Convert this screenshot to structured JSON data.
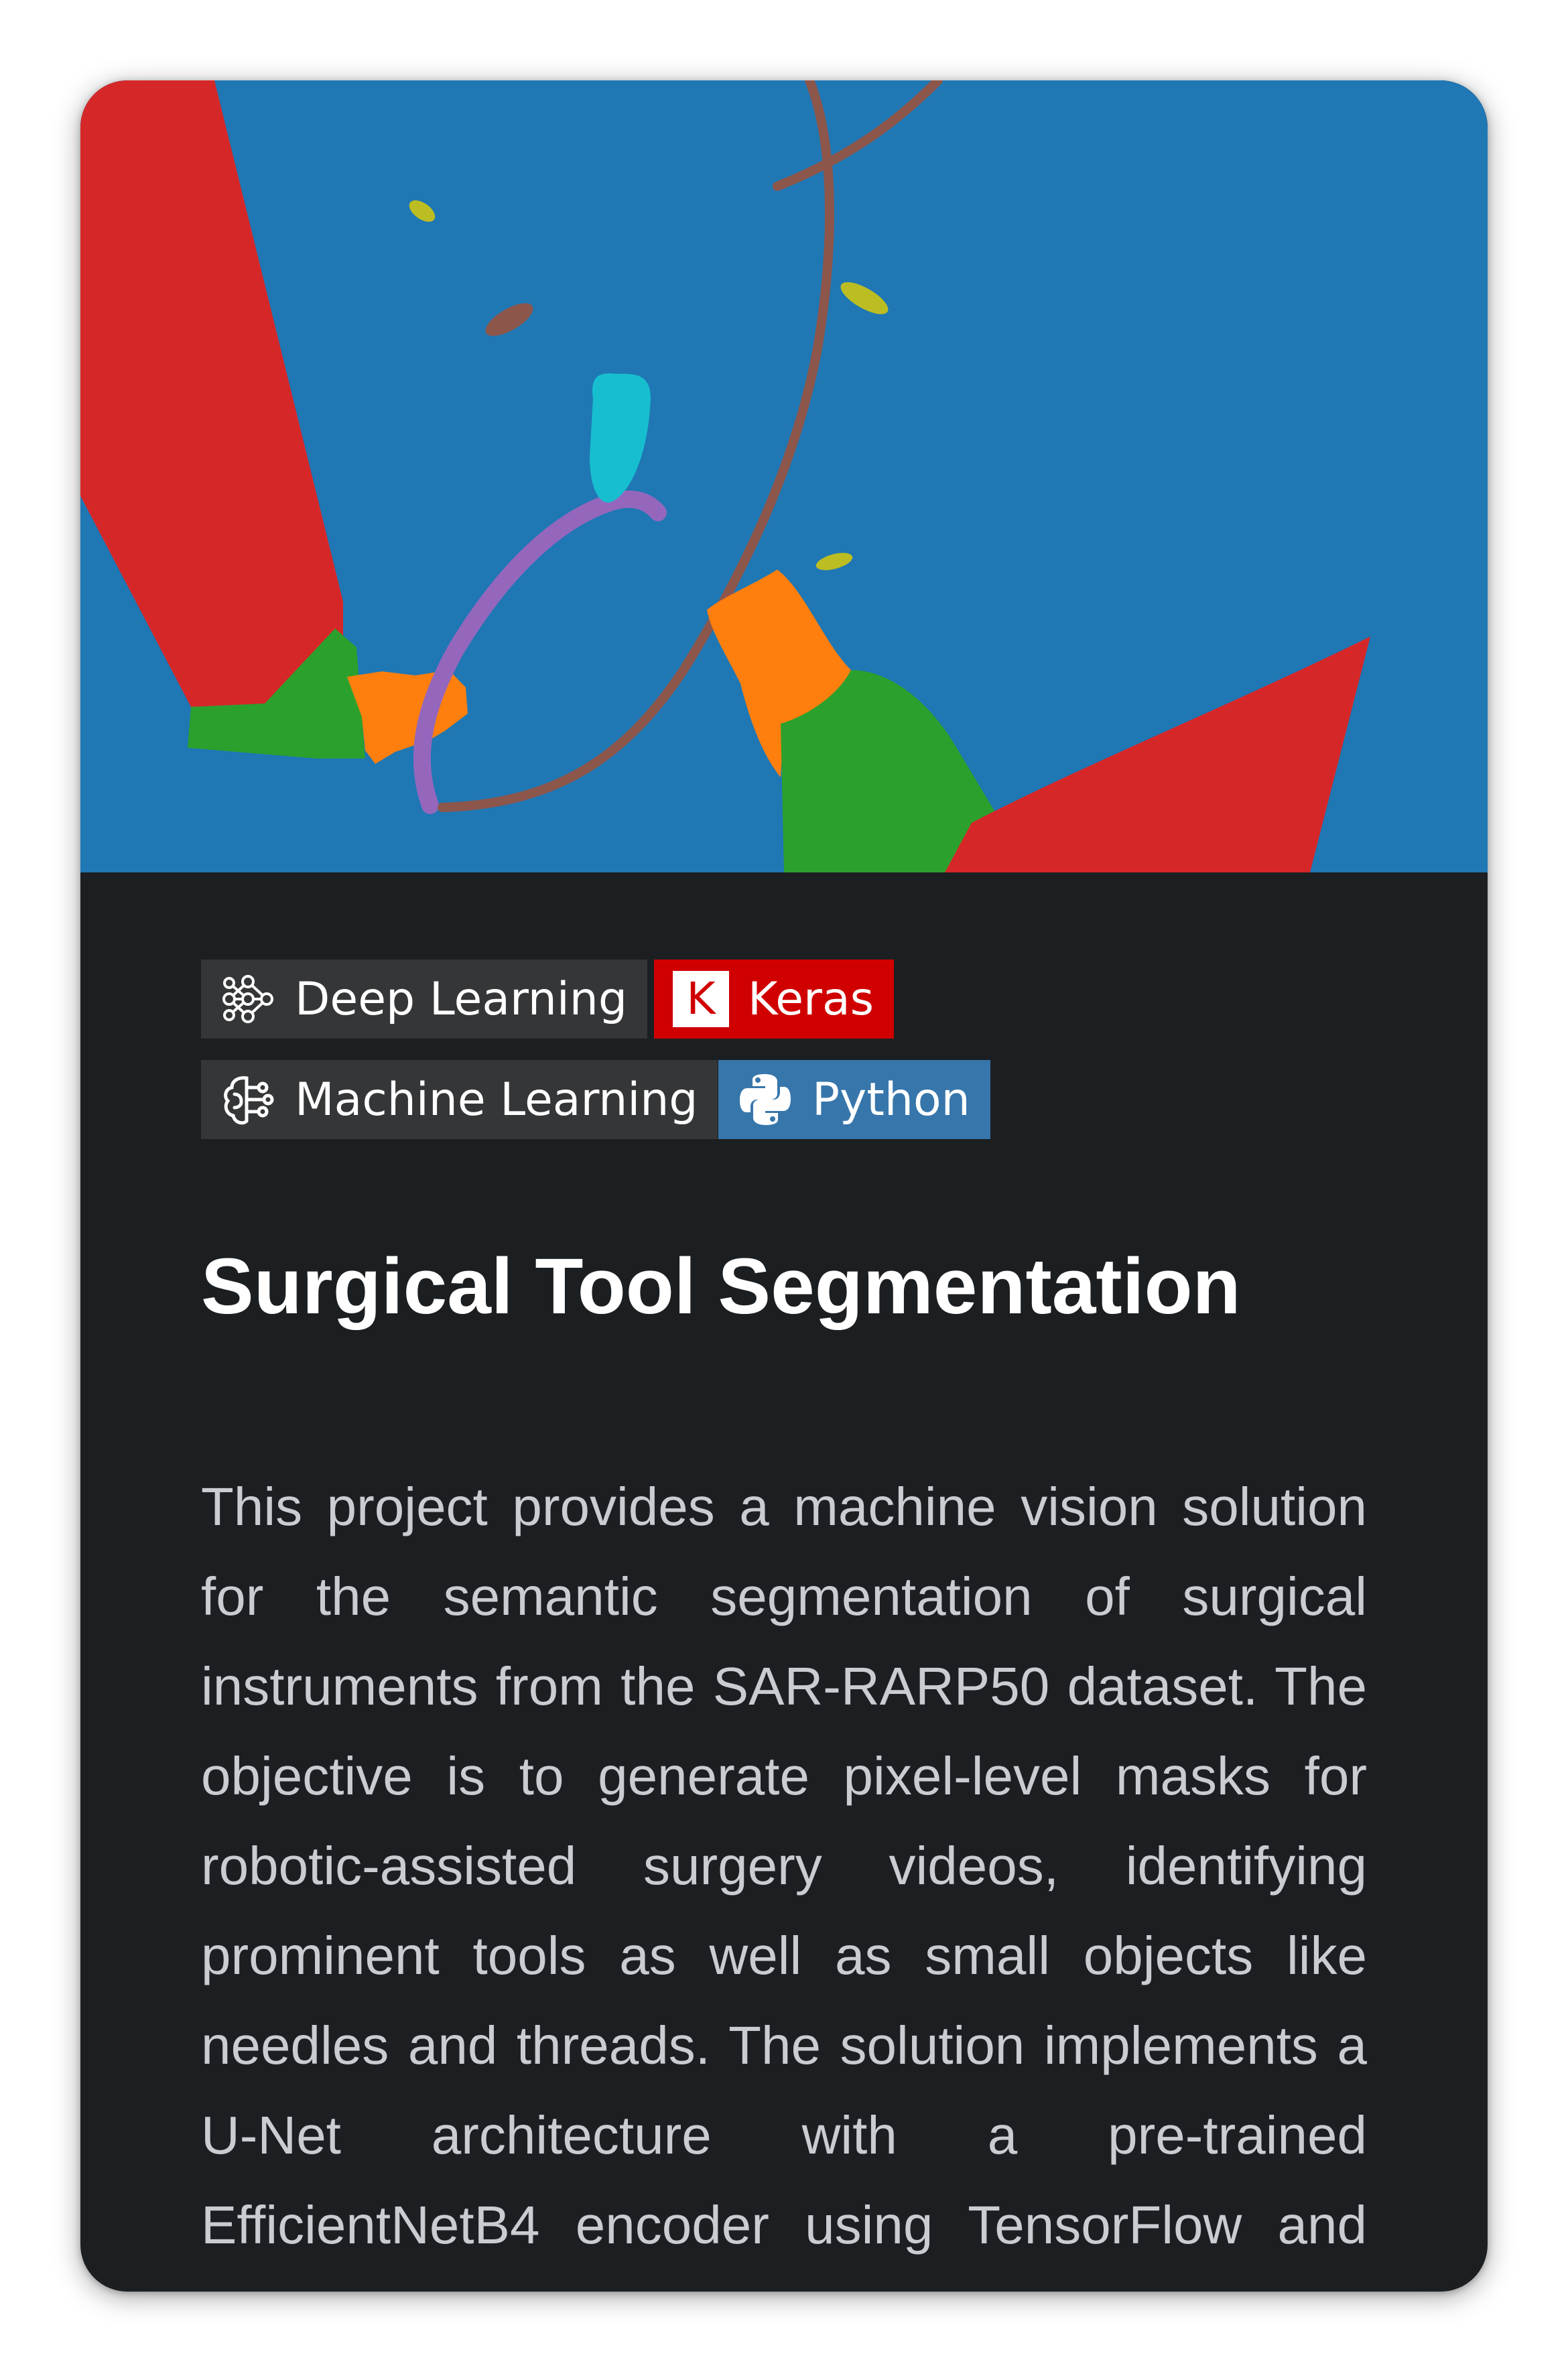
{
  "card": {
    "image_alt": "Segmentation mask of surgical instruments",
    "tags": [
      {
        "label": "Deep Learning",
        "icon": "neural-network-icon",
        "color": "#343638"
      },
      {
        "label": "Keras",
        "icon": "keras-logo-icon",
        "color": "#d00000"
      },
      {
        "label": "Machine Learning",
        "icon": "brain-circuit-icon",
        "color": "#343638"
      },
      {
        "label": "Python",
        "icon": "python-logo-icon",
        "color": "#3776ab"
      }
    ],
    "keras_letter": "K",
    "title": "Surgical Tool Segmentation",
    "description": "This project provides a machine vision solution for the semantic segmentation of surgical instruments from the SAR-RARP50 dataset. The objective is to generate pixel-level masks for robotic-assisted surgery videos, identifying prominent tools as well as small objects like needles and threads. The solution implements a U-Net architecture with a pre-trained EfficientNetB4 encoder using TensorFlow and Keras, achieving a final Test Set Mean IoU of"
  },
  "colors": {
    "card_background": "#1c1f22",
    "mask_background": "#1f77b4",
    "mask_red": "#d62728",
    "mask_green": "#2ca02c",
    "mask_orange": "#ff7f0e",
    "mask_purple": "#9467bd",
    "mask_brown": "#8c564b",
    "mask_cyan": "#17becf",
    "mask_olive": "#bcbd22"
  }
}
